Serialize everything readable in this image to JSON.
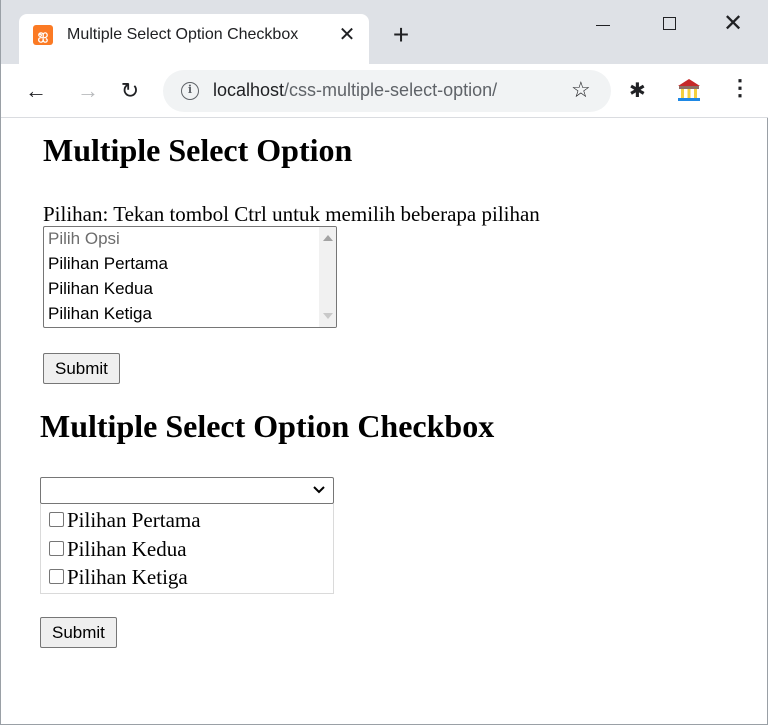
{
  "browser": {
    "tab_title": "Multiple Select Option Checkbox",
    "url_host": "localhost",
    "url_path": "/css-multiple-select-option/"
  },
  "section1": {
    "heading": "Multiple Select Option",
    "hint": "Pilihan: Tekan tombol Ctrl untuk memilih beberapa pilihan",
    "options": [
      "Pilih Opsi",
      "Pilihan Pertama",
      "Pilihan Kedua",
      "Pilihan Ketiga"
    ],
    "submit_label": "Submit"
  },
  "section2": {
    "heading": "Multiple Select Option Checkbox",
    "select_value": "",
    "checkboxes": [
      "Pilihan Pertama",
      "Pilihan Kedua",
      "Pilihan Ketiga"
    ],
    "submit_label": "Submit"
  }
}
